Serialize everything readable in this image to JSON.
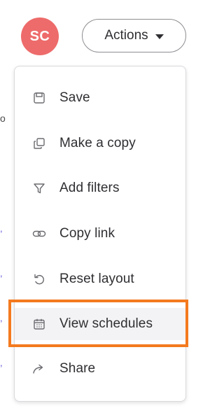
{
  "header": {
    "avatar_initials": "SC",
    "avatar_color": "#ee6b6b",
    "actions_label": "Actions"
  },
  "menu": {
    "items": [
      {
        "label": "Save",
        "icon": "save-icon"
      },
      {
        "label": "Make a copy",
        "icon": "copy-icon"
      },
      {
        "label": "Add filters",
        "icon": "filter-icon"
      },
      {
        "label": "Copy link",
        "icon": "link-icon"
      },
      {
        "label": "Reset layout",
        "icon": "reset-icon"
      },
      {
        "label": "View schedules",
        "icon": "calendar-icon"
      },
      {
        "label": "Share",
        "icon": "share-icon"
      }
    ],
    "highlighted_item": "View schedules",
    "highlight_color": "#f47a1f"
  }
}
